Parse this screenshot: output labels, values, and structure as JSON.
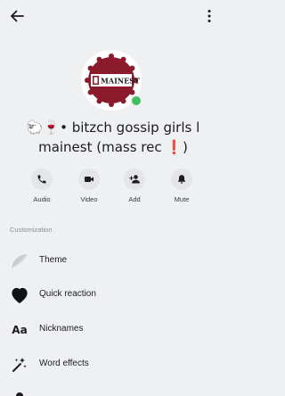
{
  "header": {
    "back_icon": "arrow-left-icon",
    "more_icon": "vertical-dots-icon"
  },
  "profile": {
    "avatar_text": "MAINEST",
    "online": true,
    "title": "🐑🍷• bitzch gossip girls l mainest (mass rec ❗)"
  },
  "actions": [
    {
      "label": "Audio",
      "icon": "phone-icon"
    },
    {
      "label": "Video",
      "icon": "video-camera-icon"
    },
    {
      "label": "Add",
      "icon": "add-person-icon"
    },
    {
      "label": "Mute",
      "icon": "bell-icon"
    }
  ],
  "customization": {
    "section_label": "Customization",
    "items": [
      {
        "label": "Theme",
        "icon": "theme-icon"
      },
      {
        "label": "Quick reaction",
        "icon": "black-heart-icon"
      },
      {
        "label": "Nicknames",
        "icon": "text-aa-icon",
        "glyph": "Aa"
      },
      {
        "label": "Word effects",
        "icon": "sparkle-wand-icon"
      }
    ]
  },
  "colors": {
    "background": "#eef0f2",
    "online": "#45bd62",
    "avatar_seal": "#8b1a2b"
  }
}
